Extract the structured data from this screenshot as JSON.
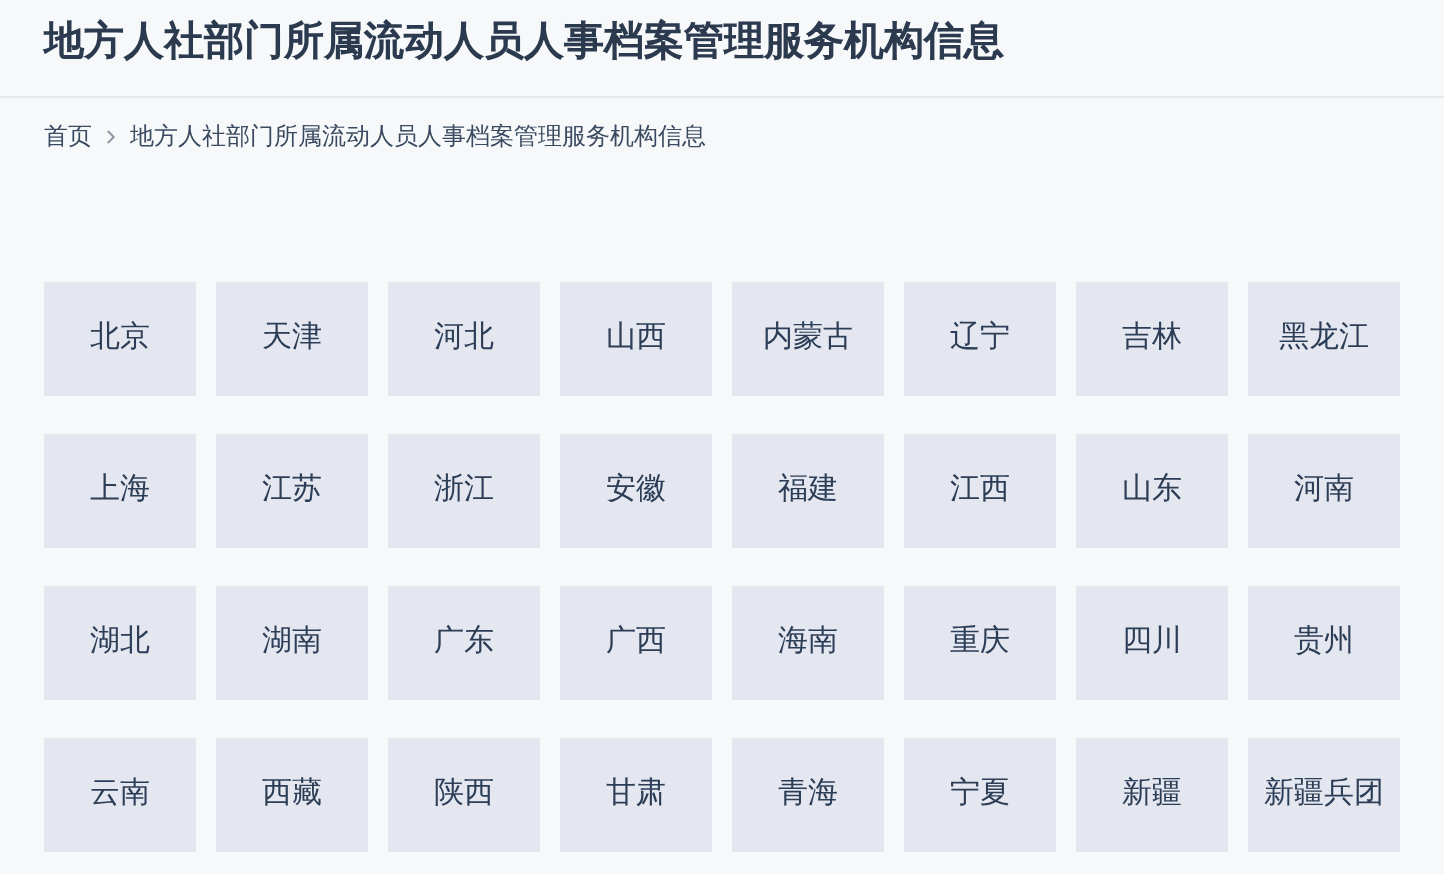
{
  "title": "地方人社部门所属流动人员人事档案管理服务机构信息",
  "breadcrumb": [
    "首页",
    "地方人社部门所属流动人员人事档案管理服务机构信息"
  ],
  "regions": [
    "北京",
    "天津",
    "河北",
    "山西",
    "内蒙古",
    "辽宁",
    "吉林",
    "黑龙江",
    "上海",
    "江苏",
    "浙江",
    "安徽",
    "福建",
    "江西",
    "山东",
    "河南",
    "湖北",
    "湖南",
    "广东",
    "广西",
    "海南",
    "重庆",
    "四川",
    "贵州",
    "云南",
    "西藏",
    "陕西",
    "甘肃",
    "青海",
    "宁夏",
    "新疆",
    "新疆兵团"
  ]
}
